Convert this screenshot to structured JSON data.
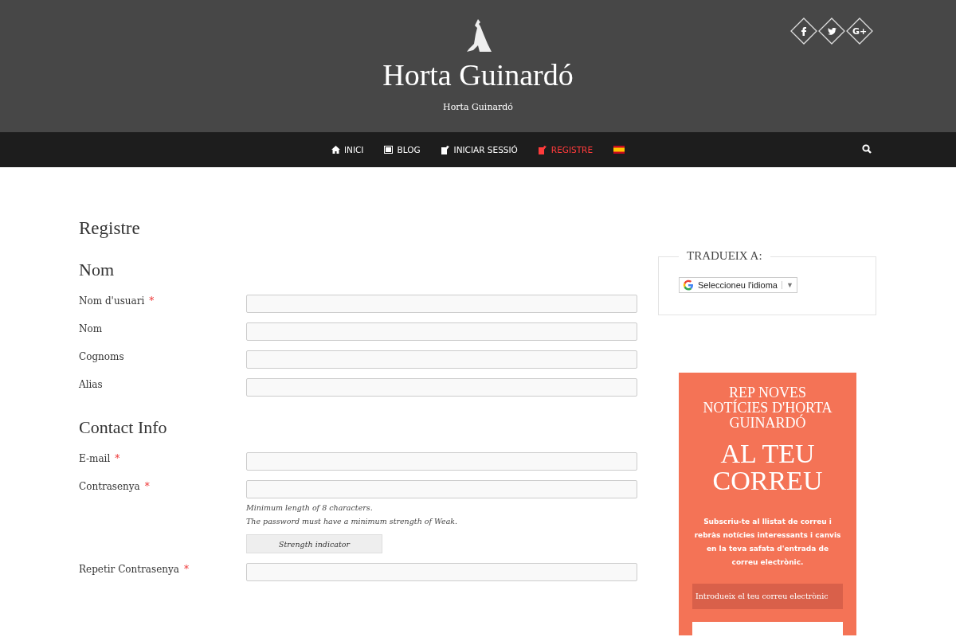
{
  "header": {
    "title": "Horta Guinardó",
    "tagline": "Horta Guinardó",
    "social": [
      {
        "kind": "facebook"
      },
      {
        "kind": "twitter"
      },
      {
        "kind": "googleplus",
        "label": "G+"
      }
    ]
  },
  "nav": {
    "items": [
      {
        "kind": "home",
        "label": "INICI",
        "selected": false
      },
      {
        "kind": "blog",
        "label": "BLOG",
        "selected": false
      },
      {
        "kind": "login",
        "label": "INICIAR SESSIÓ",
        "selected": false
      },
      {
        "kind": "register",
        "label": "REGISTRE",
        "selected": true
      },
      {
        "kind": "flag"
      }
    ]
  },
  "page": {
    "title": "Registre",
    "sections": [
      {
        "heading": "Nom",
        "fields": [
          {
            "label": "Nom d'usuari",
            "required_mark": "*"
          },
          {
            "label": "Nom"
          },
          {
            "label": "Cognoms"
          },
          {
            "label": "Alias"
          }
        ]
      },
      {
        "heading": "Contact Info",
        "fields": [
          {
            "label": "E-mail",
            "required_mark": "*"
          },
          {
            "label": "Contrasenya",
            "required_mark": "*",
            "notes": [
              "Minimum length of 8 characters.",
              "The password must have a minimum strength of Weak."
            ],
            "strength": "Strength indicator"
          },
          {
            "label": "Repetir Contrasenya",
            "required_mark": "*"
          }
        ]
      }
    ]
  },
  "sidebar": {
    "translate": {
      "title": "TRADUEIX A:",
      "select": "Seleccioneu l'idioma",
      "caret": "▼"
    },
    "subscribe": {
      "heading": "REP NOVES NOTÍCIES D'HORTA GUINARDÓ",
      "big": "AL TEU CORREU",
      "text": "Subscriu-te al llistat de correu i rebràs notícies interessants i canvis en la teva safata d'entrada de correu electrònic.",
      "placeholder": "Introdueix el teu correu electrònic"
    }
  }
}
